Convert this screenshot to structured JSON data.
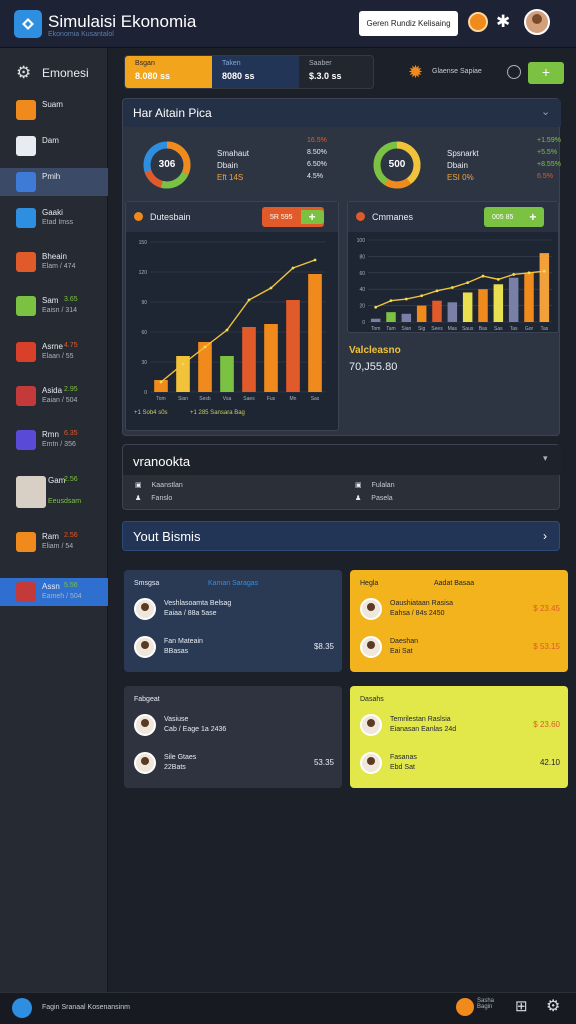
{
  "app": {
    "title": "Simulaisi Ekonomia",
    "subtitle": "Ekonomia Kusantalol",
    "top_button": "Geren Rundiz Kelisaing"
  },
  "sidebar": {
    "header": "Emonesi",
    "items": [
      {
        "label": "Suam",
        "sub": "",
        "value": "",
        "icon_color": "#f08a1c"
      },
      {
        "label": "Dam",
        "sub": "",
        "value": "",
        "icon_color": "#e8ecf2"
      },
      {
        "label": "Pmih",
        "sub": "",
        "value": "",
        "icon_color": "#3e7bd6"
      },
      {
        "label": "Gaaki",
        "sub": "Etad Imss",
        "value": "",
        "icon_color": "#2e8fe0"
      },
      {
        "label": "Bheain",
        "sub": "Elam / 474",
        "value": "",
        "icon_color": "#e05a2a"
      },
      {
        "label": "Sam",
        "sub": "Eaisn / 314",
        "value": "3.65",
        "icon_color": "#7cc242"
      },
      {
        "label": "Asrne",
        "sub": "Elaan / 55",
        "value": "4.75",
        "icon_color": "#d9402a"
      },
      {
        "label": "Asida",
        "sub": "Eaian / 504",
        "value": "2.95",
        "icon_color": "#c43a3a"
      },
      {
        "label": "Rmn",
        "sub": "Emtn / 356",
        "value": "6.35",
        "icon_color": "#5a4ad8"
      },
      {
        "label": "Gam",
        "sub": "Eeusdsam",
        "value": "2.56",
        "icon_color": "#d8d0c4"
      },
      {
        "label": "Ram",
        "sub": "Eliam / 54",
        "value": "2.56",
        "icon_color": "#f08a1c"
      },
      {
        "label": "Assn",
        "sub": "Eameh / 504",
        "value": "5.56",
        "icon_color": "#c43a3a"
      }
    ]
  },
  "stats": [
    {
      "label": "Bsgan",
      "value": "8.080 ss"
    },
    {
      "label": "Taken",
      "value": "8080 ss"
    },
    {
      "label": "Saaber",
      "value": "$.3.0 ss"
    }
  ],
  "stats_right": {
    "label": "Glaense Sapiae",
    "add": "+"
  },
  "overview": {
    "title": "Har Aitain Pica",
    "donut1": {
      "center": "306",
      "l1": "Smahaut",
      "l2": "Dbain",
      "l3": "Eft 14S",
      "pcts": [
        "16.5%",
        "8.50%",
        "6.50%",
        "4.5%"
      ]
    },
    "donut2": {
      "center": "500",
      "l1": "Spsnarkt",
      "l2": "Dbain",
      "l3": "ESI 0%",
      "pcts": [
        "+1.59%",
        "+5.5%",
        "+8.55%",
        "6.5%"
      ]
    }
  },
  "chart_left": {
    "title": "Dutesbain",
    "button": "5R 595",
    "footer1": "+1 Sob4 s0s",
    "footer2": "+1 285 Sansara Bag"
  },
  "chart_right": {
    "title": "Cmmanes",
    "button": "005 85"
  },
  "values_label": "Valcleasno",
  "values_num": "70,J55.80",
  "announcements": {
    "title": "vranookta",
    "rows": [
      {
        "a": "Kaanstlan",
        "b": "Fulalan"
      },
      {
        "a": "Fanslo",
        "b": "Pasela"
      }
    ]
  },
  "business": {
    "title": "Yout Bismis"
  },
  "business_cards": [
    {
      "h1": "Smsgsa",
      "h2": "Kaman Saragas",
      "r1n1": "Veshlasoamta Belsag",
      "r1n2": "Eaiaa / 88a 5ase",
      "r1amt": "",
      "r2n1": "Fan Mateain",
      "r2n2": "BBasas",
      "r2amt": "$8.35"
    },
    {
      "h1": "Hegla",
      "h2": "Aadat Basaa",
      "r1n1": "Oaushiataan Rasisa",
      "r1n2": "Eahsa / 84s 2450",
      "r1amt": "$ 23.45",
      "r2n1": "Daeshan",
      "r2n2": "Eai Sat",
      "r2amt": "$ 53.15"
    },
    {
      "h1": "Fabgeat",
      "h2": "",
      "r1n1": "Vasiuse",
      "r1n2": "Cab / Eage 1a 2436",
      "r1amt": "",
      "r2n1": "Sile Gtaes",
      "r2n2": "22Bats",
      "r2amt": "53.35"
    },
    {
      "h1": "Dasahs",
      "h2": "",
      "r1n1": "Temrilestan Raslsia",
      "r1n2": "Eianasan Eanlas 24d",
      "r1amt": "$ 23.60",
      "r2n1": "Fasanas",
      "r2n2": "Ebd Sat",
      "r2amt": "42.10"
    }
  ],
  "bottombar": {
    "text": "Fagin Sranaal Kosenansinm",
    "coin_label": "Sasha\nBagin"
  },
  "chart_data": [
    {
      "type": "bar",
      "title": "Dutesbain",
      "categories": [
        "Tom",
        "Sian",
        "Sesb",
        "Vsa",
        "Saes",
        "Fus",
        "Mn",
        "Sas"
      ],
      "values": [
        12,
        36,
        50,
        36,
        65,
        68,
        92,
        118
      ],
      "line": [
        10,
        28,
        45,
        62,
        92,
        104,
        124,
        132
      ],
      "colors": [
        "#f08a1c",
        "#f2c23a",
        "#f08a1c",
        "#7cc242",
        "#e05a2a",
        "#f08a1c",
        "#e05a2a",
        "#f08a1c"
      ],
      "ylim": [
        0,
        150
      ]
    },
    {
      "type": "bar",
      "title": "Cmmanes",
      "categories": [
        "Tom",
        "Tam",
        "Sian",
        "Sig",
        "Sees",
        "Mas",
        "Saus",
        "Bas",
        "Sas",
        "Tas",
        "Gor",
        "Tas"
      ],
      "values": [
        4,
        12,
        10,
        20,
        26,
        24,
        36,
        40,
        46,
        54,
        60,
        84
      ],
      "line": [
        18,
        26,
        28,
        32,
        38,
        42,
        48,
        56,
        52,
        58,
        60,
        62
      ],
      "colors": [
        "#7a7fa8",
        "#7cc242",
        "#7a7fa8",
        "#f08a1c",
        "#e05a2a",
        "#7a7fa8",
        "#e8e050",
        "#f08a1c",
        "#e8e050",
        "#7a7fa8",
        "#f08a1c",
        "#f2a13a"
      ],
      "ylim": [
        0,
        100
      ]
    }
  ]
}
